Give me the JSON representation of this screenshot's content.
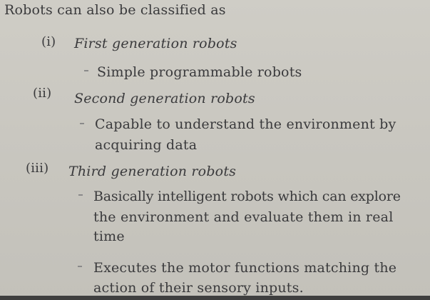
{
  "intro": "Robots can  also be classified as",
  "items": [
    {
      "number": "(i)",
      "heading": "First generation robots",
      "points": [
        {
          "lines": [
            "Simple programmable robots"
          ]
        }
      ]
    },
    {
      "number": "(ii)",
      "heading": "Second generation robots",
      "points": [
        {
          "lines": [
            "Capable to understand the environment by",
            "acquiring data"
          ]
        }
      ]
    },
    {
      "number": "(iii)",
      "heading": "Third generation robots",
      "points": [
        {
          "lines": [
            "Basically intelligent robots which can explore",
            "the environment and evaluate them in real",
            "time"
          ]
        },
        {
          "lines": [
            "Executes the motor functions matching the",
            "action of their sensory inputs."
          ]
        }
      ]
    }
  ]
}
